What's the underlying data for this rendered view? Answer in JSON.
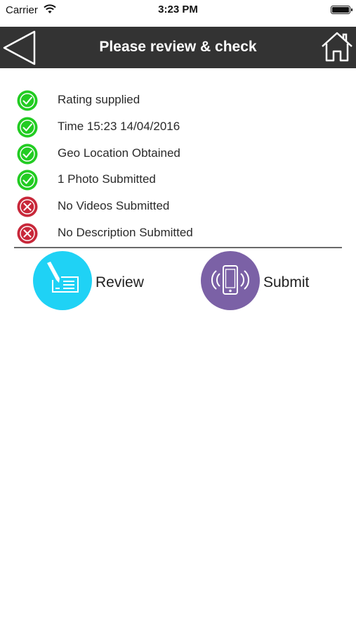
{
  "status_bar": {
    "carrier": "Carrier",
    "time": "3:23 PM"
  },
  "nav": {
    "title": "Please review & check",
    "back_icon": "back-triangle-icon",
    "home_icon": "home-icon",
    "bar_color": "#333333"
  },
  "checklist": [
    {
      "label": "Rating supplied",
      "status": "ok"
    },
    {
      "label": "Time 15:23 14/04/2016",
      "status": "ok"
    },
    {
      "label": "Geo Location Obtained",
      "status": "ok"
    },
    {
      "label": "1 Photo Submitted",
      "status": "ok"
    },
    {
      "label": "No Videos Submitted",
      "status": "missing"
    },
    {
      "label": "No Description Submitted",
      "status": "missing"
    }
  ],
  "colors": {
    "ok": "#22cc22",
    "missing": "#c8283a",
    "review": "#1fd2f5",
    "submit": "#7b61a6"
  },
  "actions": {
    "review_label": "Review",
    "submit_label": "Submit"
  }
}
